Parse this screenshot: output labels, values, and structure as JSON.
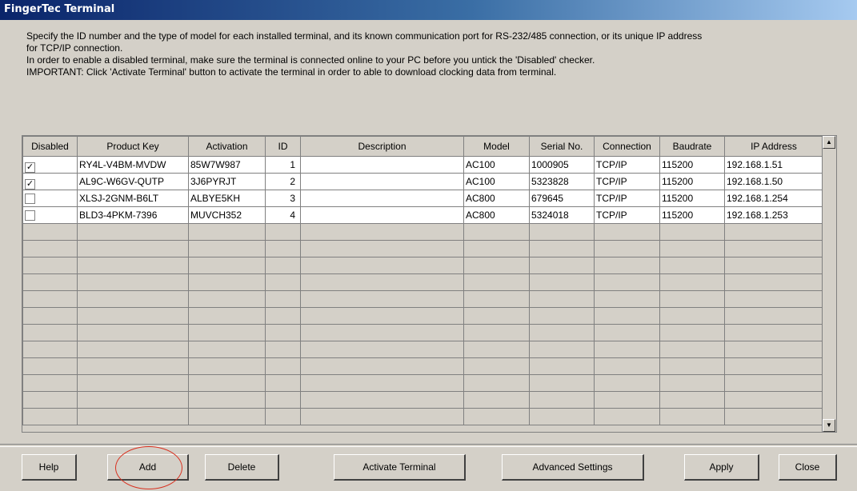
{
  "window": {
    "title": "FingerTec Terminal"
  },
  "instructions": [
    "Specify the ID number and the type of model for each installed terminal, and its known communication port for RS-232/485 connection, or its unique IP address",
    "for TCP/IP connection.",
    "In order to enable a disabled terminal, make sure the terminal is connected online to your PC before you untick the 'Disabled' checker.",
    "IMPORTANT: Click 'Activate Terminal' button to activate the terminal in order to able to download clocking data from terminal."
  ],
  "grid": {
    "columns": [
      "Disabled",
      "Product Key",
      "Activation",
      "ID",
      "Description",
      "Model",
      "Serial No.",
      "Connection",
      "Baudrate",
      "IP Address"
    ],
    "rows": [
      {
        "disabled": true,
        "product_key": "RY4L-V4BM-MVDW",
        "activation": "85W7W987",
        "id": "1",
        "description": "",
        "model": "AC100",
        "serial": "1000905",
        "connection": "TCP/IP",
        "baudrate": "115200",
        "ip": "192.168.1.51"
      },
      {
        "disabled": true,
        "product_key": "AL9C-W6GV-QUTP",
        "activation": "3J6PYRJT",
        "id": "2",
        "description": "",
        "model": "AC100",
        "serial": "5323828",
        "connection": "TCP/IP",
        "baudrate": "115200",
        "ip": "192.168.1.50"
      },
      {
        "disabled": false,
        "product_key": "XLSJ-2GNM-B6LT",
        "activation": "ALBYE5KH",
        "id": "3",
        "description": "",
        "model": "AC800",
        "serial": "679645",
        "connection": "TCP/IP",
        "baudrate": "115200",
        "ip": "192.168.1.254"
      },
      {
        "disabled": false,
        "product_key": "BLD3-4PKM-7396",
        "activation": "MUVCH352",
        "id": "4",
        "description": "",
        "model": "AC800",
        "serial": "5324018",
        "connection": "TCP/IP",
        "baudrate": "115200",
        "ip": "192.168.1.253"
      }
    ],
    "check_mark": "✓",
    "empty_rows": 12
  },
  "scrollbar": {
    "up_icon": "scroll-up-icon",
    "down_icon": "scroll-down-icon"
  },
  "buttons": {
    "help": "Help",
    "add": "Add",
    "delete": "Delete",
    "activate": "Activate Terminal",
    "advanced": "Advanced Settings",
    "apply": "Apply",
    "close": "Close"
  },
  "colors": {
    "title_start": "#0a246a",
    "title_end": "#a6caf0",
    "face": "#d4d0c8",
    "annotation": "#d9301f"
  }
}
